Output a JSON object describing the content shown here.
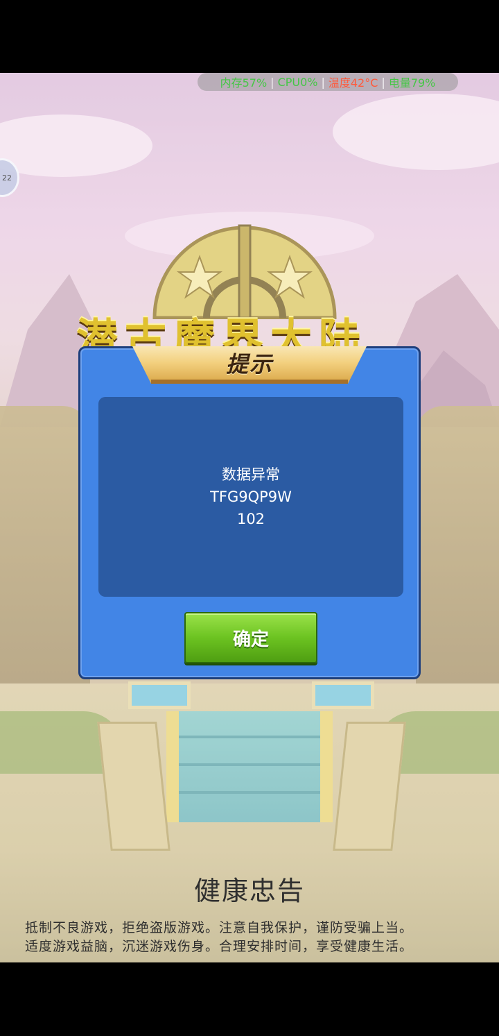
{
  "status_overlay": {
    "memory": "内存57%",
    "cpu": "CPU0%",
    "temperature": "温度42°C",
    "battery": "电量79%",
    "colors": {
      "memory": "#45c646",
      "cpu": "#45c646",
      "temperature": "#ff5a3c",
      "battery": "#45c646"
    }
  },
  "side_float": {
    "label": "22"
  },
  "logo": {
    "text": "潜古魔界大陆"
  },
  "dialog": {
    "title": "提示",
    "message_lines": [
      "数据异常",
      "TFG9QP9W",
      "102"
    ],
    "confirm_label": "确定"
  },
  "health_notice": {
    "title": "健康忠告",
    "line1": "抵制不良游戏，拒绝盗版游戏。注意自我保护，谨防受骗上当。",
    "line2": "适度游戏益脑，沉迷游戏伤身。合理安排时间，享受健康生活。"
  }
}
